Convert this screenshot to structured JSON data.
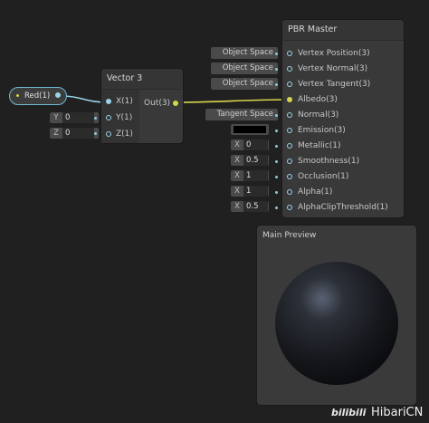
{
  "red_node": {
    "label": "Red(1)"
  },
  "vector3": {
    "title": "Vector 3",
    "inputs": [
      "X(1)",
      "Y(1)",
      "Z(1)"
    ],
    "output": "Out(3)",
    "fields": [
      {
        "axis": "Y",
        "value": "0"
      },
      {
        "axis": "Z",
        "value": "0"
      }
    ]
  },
  "pbr": {
    "title": "PBR Master",
    "ports": [
      "Vertex Position(3)",
      "Vertex Normal(3)",
      "Vertex Tangent(3)",
      "Albedo(3)",
      "Normal(3)",
      "Emission(3)",
      "Metallic(1)",
      "Smoothness(1)",
      "Occlusion(1)",
      "Alpha(1)",
      "AlphaClipThreshold(1)"
    ],
    "space_tags": [
      "Object Space",
      "Object Space",
      "Object Space",
      "Tangent Space"
    ],
    "value_fields": [
      {
        "axis": "X",
        "value": "0"
      },
      {
        "axis": "X",
        "value": "0.5"
      },
      {
        "axis": "X",
        "value": "1"
      },
      {
        "axis": "X",
        "value": "1"
      },
      {
        "axis": "X",
        "value": "0.5"
      }
    ],
    "emission_color": "#000000"
  },
  "preview": {
    "title": "Main Preview"
  },
  "watermark": {
    "brand": "bilibili",
    "user": "HibariCN"
  },
  "colors": {
    "vector_wire": "#9ad4e8",
    "vector3_wire": "#d6d64c",
    "accent_red": "#d6d64c"
  }
}
